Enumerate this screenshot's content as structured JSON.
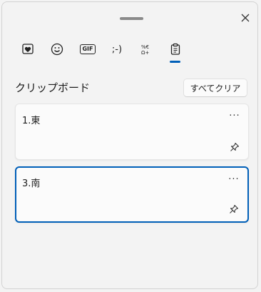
{
  "header": {
    "tabs": [
      {
        "name": "kaomoji-favorites",
        "icon": "heart-icon"
      },
      {
        "name": "emoji",
        "icon": "smiley-icon"
      },
      {
        "name": "gif",
        "icon": "gif-icon",
        "label": "GIF"
      },
      {
        "name": "kaomoji",
        "icon": "kaomoji-icon",
        "label": ";-)"
      },
      {
        "name": "symbols",
        "icon": "symbols-icon",
        "label": "%€ Ω+"
      },
      {
        "name": "clipboard",
        "icon": "clipboard-icon",
        "selected": true
      }
    ],
    "accent": "#005fb8"
  },
  "clipboard": {
    "title": "クリップボード",
    "clear_all_label": "すべてクリア",
    "items": [
      {
        "text": "1.東",
        "more": "···"
      },
      {
        "text": "3.南",
        "more": "···",
        "selected": true
      }
    ]
  }
}
